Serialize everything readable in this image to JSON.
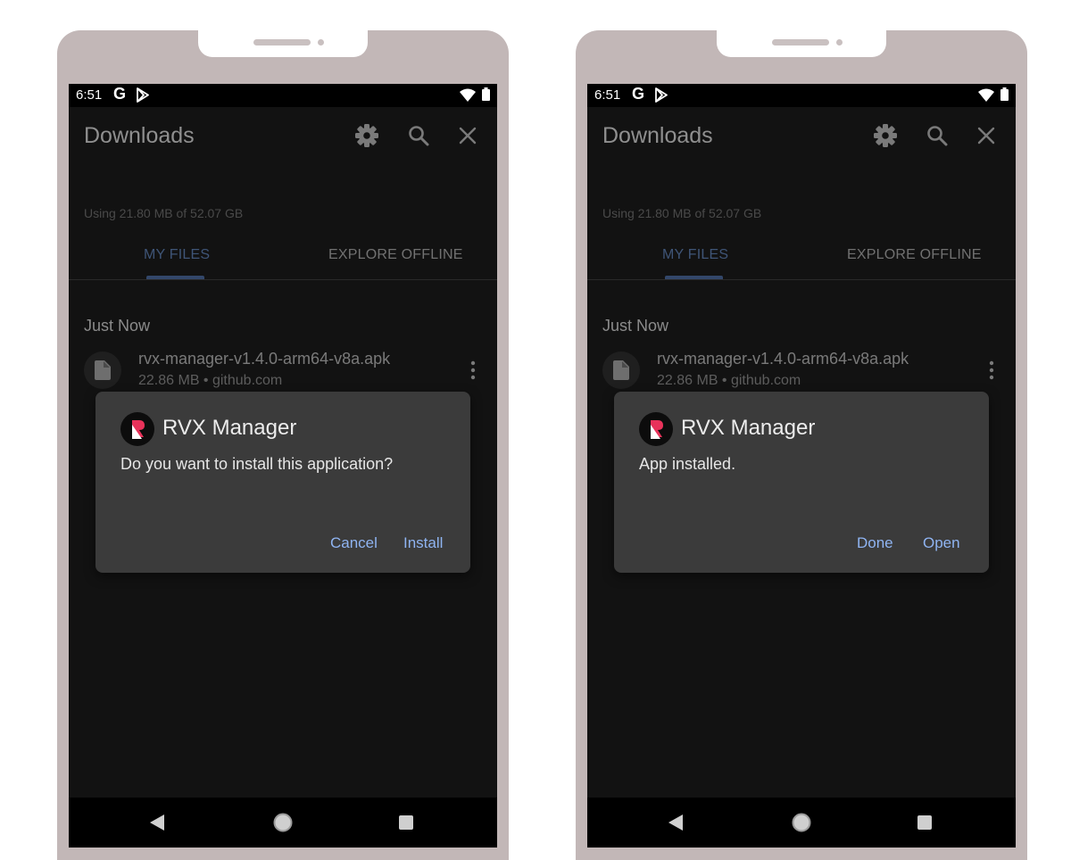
{
  "colors": {
    "phone_frame": "#c2b7b7",
    "screen_bg": "#121212",
    "dialog_bg": "#3b3b3b",
    "accent_button": "#8fb4f2",
    "active_tab": "#3f5577"
  },
  "status": {
    "time": "6:51",
    "google_glyph": "G"
  },
  "downloads": {
    "title": "Downloads",
    "storage": "Using 21.80 MB of 52.07 GB",
    "tabs": [
      "MY FILES",
      "EXPLORE OFFLINE"
    ],
    "section": "Just Now",
    "file": {
      "name": "rvx-manager-v1.4.0-arm64-v8a.apk",
      "meta": "22.86 MB • github.com"
    }
  },
  "icons": [
    "gear-icon",
    "search-icon",
    "close-icon",
    "file-icon",
    "more-vert-icon",
    "wifi-icon",
    "battery-icon",
    "play-store-icon",
    "back-icon",
    "home-icon",
    "recents-icon"
  ],
  "phones": [
    {
      "dialog": {
        "title": "RVX Manager",
        "message": "Do you want to install this application?",
        "secondary_button": "Cancel",
        "primary_button": "Install"
      }
    },
    {
      "dialog": {
        "title": "RVX Manager",
        "message": "App installed.",
        "secondary_button": "Done",
        "primary_button": "Open"
      }
    }
  ]
}
